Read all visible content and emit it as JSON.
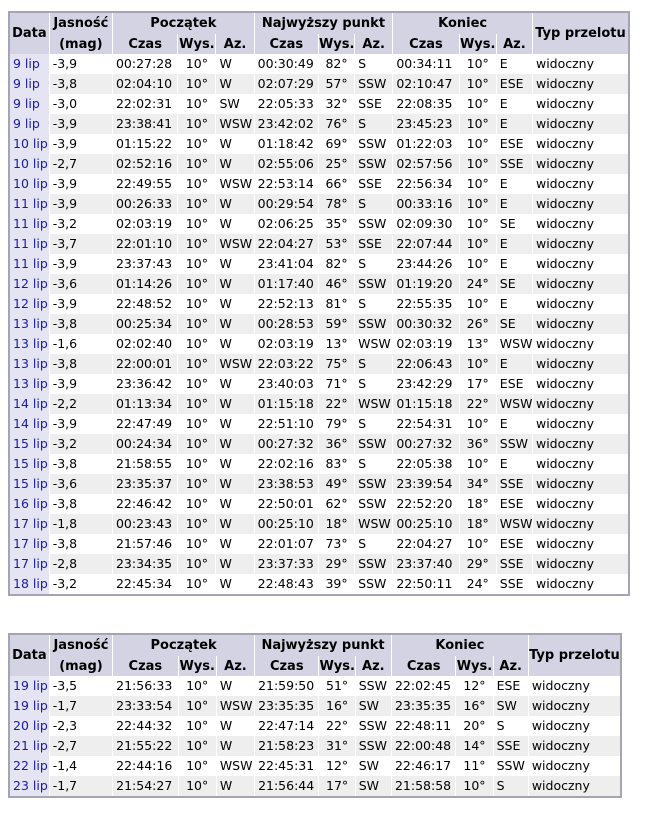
{
  "header": {
    "date": "Data",
    "brightness_line1": "Jasność",
    "brightness_line2": "(mag)",
    "start": "Początek",
    "peak": "Najwyższy punkt",
    "end": "Koniec",
    "pass_type": "Typ przelotu",
    "time": "Czas",
    "alt": "Wys.",
    "az": "Az."
  },
  "table1": [
    [
      "9 lip",
      "-3,9",
      "00:27:28",
      "10°",
      "W",
      "00:30:49",
      "82°",
      "S",
      "00:34:11",
      "10°",
      "E",
      "widoczny"
    ],
    [
      "9 lip",
      "-3,8",
      "02:04:10",
      "10°",
      "W",
      "02:07:29",
      "57°",
      "SSW",
      "02:10:47",
      "10°",
      "ESE",
      "widoczny"
    ],
    [
      "9 lip",
      "-3,0",
      "22:02:31",
      "10°",
      "SW",
      "22:05:33",
      "32°",
      "SSE",
      "22:08:35",
      "10°",
      "E",
      "widoczny"
    ],
    [
      "9 lip",
      "-3,9",
      "23:38:41",
      "10°",
      "WSW",
      "23:42:02",
      "76°",
      "S",
      "23:45:23",
      "10°",
      "E",
      "widoczny"
    ],
    [
      "10 lip",
      "-3,9",
      "01:15:22",
      "10°",
      "W",
      "01:18:42",
      "69°",
      "SSW",
      "01:22:03",
      "10°",
      "ESE",
      "widoczny"
    ],
    [
      "10 lip",
      "-2,7",
      "02:52:16",
      "10°",
      "W",
      "02:55:06",
      "25°",
      "SSW",
      "02:57:56",
      "10°",
      "SSE",
      "widoczny"
    ],
    [
      "10 lip",
      "-3,9",
      "22:49:55",
      "10°",
      "WSW",
      "22:53:14",
      "66°",
      "SSE",
      "22:56:34",
      "10°",
      "E",
      "widoczny"
    ],
    [
      "11 lip",
      "-3,9",
      "00:26:33",
      "10°",
      "W",
      "00:29:54",
      "78°",
      "S",
      "00:33:16",
      "10°",
      "E",
      "widoczny"
    ],
    [
      "11 lip",
      "-3,2",
      "02:03:19",
      "10°",
      "W",
      "02:06:25",
      "35°",
      "SSW",
      "02:09:30",
      "10°",
      "SE",
      "widoczny"
    ],
    [
      "11 lip",
      "-3,7",
      "22:01:10",
      "10°",
      "WSW",
      "22:04:27",
      "53°",
      "SSE",
      "22:07:44",
      "10°",
      "E",
      "widoczny"
    ],
    [
      "11 lip",
      "-3,9",
      "23:37:43",
      "10°",
      "W",
      "23:41:04",
      "82°",
      "S",
      "23:44:26",
      "10°",
      "E",
      "widoczny"
    ],
    [
      "12 lip",
      "-3,6",
      "01:14:26",
      "10°",
      "W",
      "01:17:40",
      "46°",
      "SSW",
      "01:19:20",
      "24°",
      "SE",
      "widoczny"
    ],
    [
      "12 lip",
      "-3,9",
      "22:48:52",
      "10°",
      "W",
      "22:52:13",
      "81°",
      "S",
      "22:55:35",
      "10°",
      "E",
      "widoczny"
    ],
    [
      "13 lip",
      "-3,8",
      "00:25:34",
      "10°",
      "W",
      "00:28:53",
      "59°",
      "SSW",
      "00:30:32",
      "26°",
      "SE",
      "widoczny"
    ],
    [
      "13 lip",
      "-1,6",
      "02:02:40",
      "10°",
      "W",
      "02:03:19",
      "13°",
      "WSW",
      "02:03:19",
      "13°",
      "WSW",
      "widoczny"
    ],
    [
      "13 lip",
      "-3,8",
      "22:00:01",
      "10°",
      "WSW",
      "22:03:22",
      "75°",
      "S",
      "22:06:43",
      "10°",
      "E",
      "widoczny"
    ],
    [
      "13 lip",
      "-3,9",
      "23:36:42",
      "10°",
      "W",
      "23:40:03",
      "71°",
      "S",
      "23:42:29",
      "17°",
      "ESE",
      "widoczny"
    ],
    [
      "14 lip",
      "-2,2",
      "01:13:34",
      "10°",
      "W",
      "01:15:18",
      "22°",
      "WSW",
      "01:15:18",
      "22°",
      "WSW",
      "widoczny"
    ],
    [
      "14 lip",
      "-3,9",
      "22:47:49",
      "10°",
      "W",
      "22:51:10",
      "79°",
      "S",
      "22:54:31",
      "10°",
      "E",
      "widoczny"
    ],
    [
      "15 lip",
      "-3,2",
      "00:24:34",
      "10°",
      "W",
      "00:27:32",
      "36°",
      "SSW",
      "00:27:32",
      "36°",
      "SSW",
      "widoczny"
    ],
    [
      "15 lip",
      "-3,8",
      "21:58:55",
      "10°",
      "W",
      "22:02:16",
      "83°",
      "S",
      "22:05:38",
      "10°",
      "E",
      "widoczny"
    ],
    [
      "15 lip",
      "-3,6",
      "23:35:37",
      "10°",
      "W",
      "23:38:53",
      "49°",
      "SSW",
      "23:39:54",
      "34°",
      "SSE",
      "widoczny"
    ],
    [
      "16 lip",
      "-3,8",
      "22:46:42",
      "10°",
      "W",
      "22:50:01",
      "62°",
      "SSW",
      "22:52:20",
      "18°",
      "ESE",
      "widoczny"
    ],
    [
      "17 lip",
      "-1,8",
      "00:23:43",
      "10°",
      "W",
      "00:25:10",
      "18°",
      "WSW",
      "00:25:10",
      "18°",
      "WSW",
      "widoczny"
    ],
    [
      "17 lip",
      "-3,8",
      "21:57:46",
      "10°",
      "W",
      "22:01:07",
      "73°",
      "S",
      "22:04:27",
      "10°",
      "ESE",
      "widoczny"
    ],
    [
      "17 lip",
      "-2,8",
      "23:34:35",
      "10°",
      "W",
      "23:37:33",
      "29°",
      "SSW",
      "23:37:40",
      "29°",
      "SSE",
      "widoczny"
    ],
    [
      "18 lip",
      "-3,2",
      "22:45:34",
      "10°",
      "W",
      "22:48:43",
      "39°",
      "SSW",
      "22:50:11",
      "24°",
      "SSE",
      "widoczny"
    ]
  ],
  "table2": [
    [
      "19 lip",
      "-3,5",
      "21:56:33",
      "10°",
      "W",
      "21:59:50",
      "51°",
      "SSW",
      "22:02:45",
      "12°",
      "ESE",
      "widoczny"
    ],
    [
      "19 lip",
      "-1,7",
      "23:33:54",
      "10°",
      "WSW",
      "23:35:35",
      "16°",
      "SW",
      "23:35:35",
      "16°",
      "SW",
      "widoczny"
    ],
    [
      "20 lip",
      "-2,3",
      "22:44:32",
      "10°",
      "W",
      "22:47:14",
      "22°",
      "SSW",
      "22:48:11",
      "20°",
      "S",
      "widoczny"
    ],
    [
      "21 lip",
      "-2,7",
      "21:55:22",
      "10°",
      "W",
      "21:58:23",
      "31°",
      "SSW",
      "22:00:48",
      "14°",
      "SSE",
      "widoczny"
    ],
    [
      "22 lip",
      "-1,4",
      "22:44:16",
      "10°",
      "WSW",
      "22:45:31",
      "12°",
      "SW",
      "22:46:17",
      "11°",
      "SSW",
      "widoczny"
    ],
    [
      "23 lip",
      "-1,7",
      "21:54:27",
      "10°",
      "W",
      "21:56:44",
      "17°",
      "SW",
      "21:58:58",
      "10°",
      "S",
      "widoczny"
    ]
  ]
}
